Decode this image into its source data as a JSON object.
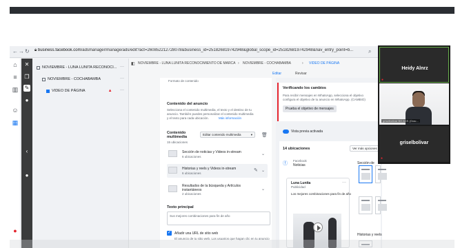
{
  "browser": {
    "url_host": "business.facebook.com",
    "url_rest": "/adsmanager/manage/ads/edit?act=260852212728078&business_id=251826819742948&global_scope_id=251826819742948&nav_entry_point=b..."
  },
  "tree": {
    "campaign": "NOVIEMBRE - LUNA LUNITA RECONOCI...",
    "adset": "NOVIEMBRE - COCHABAMBA",
    "ad": "VIDEO DE PÁGINA"
  },
  "breadcrumb": {
    "item1": "NOVIEMBRE - LUNA LUNITA RECONOCIMIENTO DE MARCA",
    "item2": "NOVIEMBRE - COCHABAMBA",
    "item3": "VIDEO DE PÁGINA",
    "edit_label": "Editar",
    "review_label": "Revisar"
  },
  "editor": {
    "top_item": "Formato de contenido",
    "section_title": "Contenido del anuncio",
    "section_desc_1": "Selecciona el contenido multimedia, el texto y el destino de tu",
    "section_desc_2": "anuncio. También puedes personalizar el contenido multimedia",
    "section_desc_3": "y el texto para cada ubicación.",
    "section_more": "Más información",
    "media_label_1": "Contenido",
    "media_label_2": "multimedia",
    "media_count": "15 ubicaciones",
    "edit_media_button": "Editar contenido multimedia",
    "rows": [
      {
        "title": "Sección de noticias y Videos in-stream",
        "sub": "6 ubicaciones"
      },
      {
        "title": "Historias y reels y Videos in-stream",
        "sub": "6 ubicaciones"
      },
      {
        "title": "Resultados de la búsqueda y Artículos",
        "title2": "instantáneos",
        "sub": "2 ubicaciones"
      }
    ],
    "primary_text_label": "Texto principal",
    "primary_text_value": "Sus mejores combinaciones para fin de año",
    "url_checkbox_label": "Añadir una URL de sitio web",
    "url_desc": "El anuncio de tu sitio web. Los usuarios que hagan clic en tu anuncio"
  },
  "verify": {
    "title": "Verificando los cambios",
    "desc_1": "Para recibir mensajes en WhatsApp, selecciona el objetivo",
    "desc_2": "configura el objetivo de tu anuncio en WhatsApp. (CAMBIO)",
    "button": "Prueba el objetivo de mensajes"
  },
  "preview": {
    "toggle_label": "Vista previa activada",
    "count_label": "14 ubicaciones",
    "view_select": "Ver más opciones",
    "placement_label": "Facebook",
    "placement_sub": "Noticias",
    "section_label": "Sección de",
    "card_page": "Luna Lunita",
    "card_sub": "Publicidad",
    "card_text": "Los mejores combinaciones para fin de año",
    "bottom_label": "Historias y reels"
  },
  "call": {
    "participant_1": "Heidy Alnrz",
    "participant_2_small": "griselbolivar BO ADS (Grac...",
    "participant_3": "griselbolivar"
  }
}
